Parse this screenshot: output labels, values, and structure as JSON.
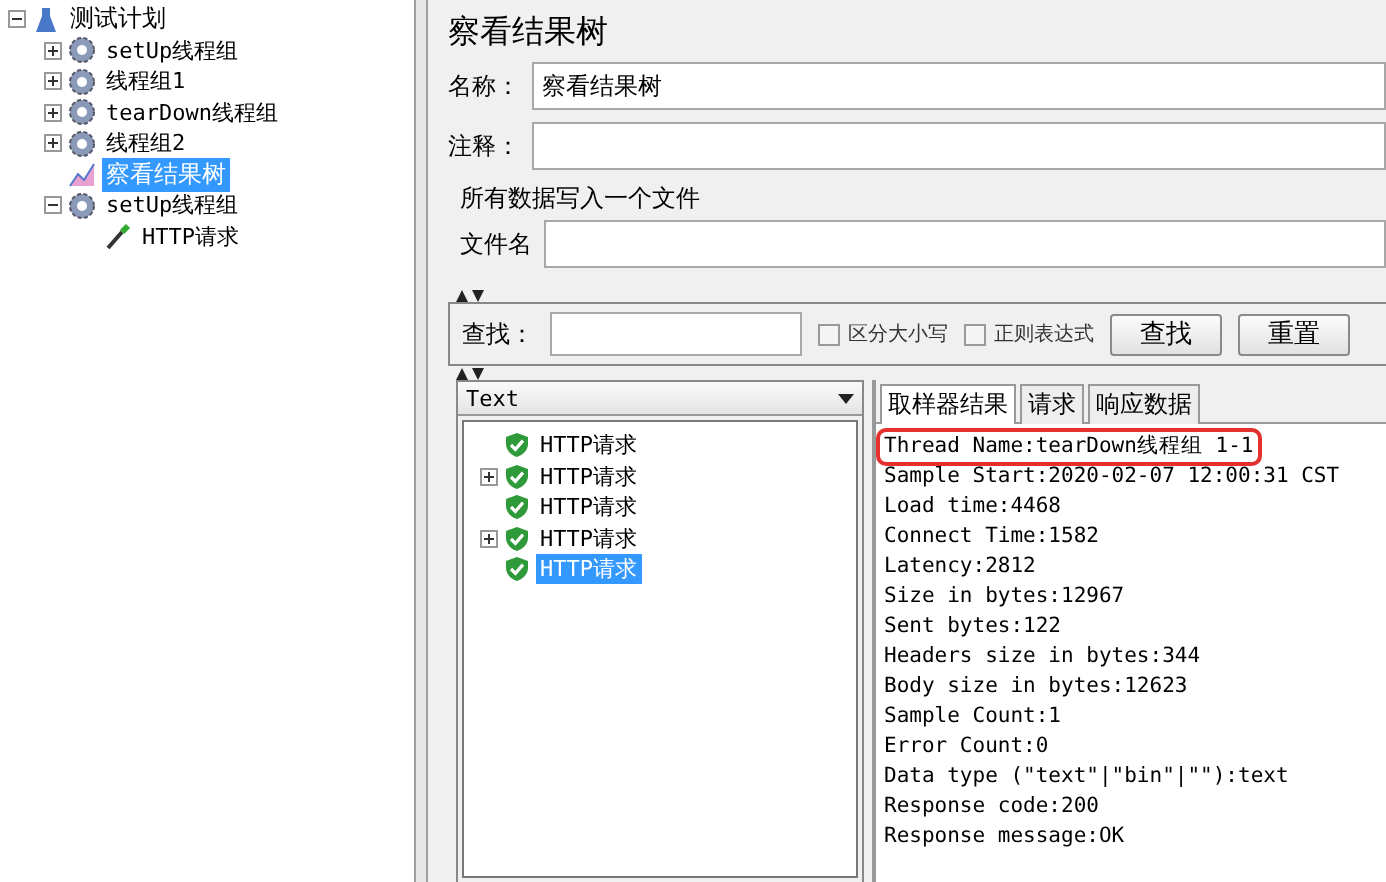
{
  "test_plan": {
    "label": "测试计划",
    "expanded": true,
    "children": [
      {
        "label": "setUp线程组",
        "kind": "thread_group",
        "expanded": false,
        "selected": false
      },
      {
        "label": "线程组1",
        "kind": "thread_group",
        "expanded": false,
        "selected": false
      },
      {
        "label": "tearDown线程组",
        "kind": "thread_group",
        "expanded": false,
        "selected": false
      },
      {
        "label": "线程组2",
        "kind": "thread_group",
        "expanded": false,
        "selected": false
      },
      {
        "label": "察看结果树",
        "kind": "listener",
        "selected": true
      },
      {
        "label": "setUp线程组",
        "kind": "thread_group",
        "expanded": true,
        "selected": false,
        "children": [
          {
            "label": "HTTP请求",
            "kind": "sampler",
            "selected": false
          }
        ]
      }
    ]
  },
  "panel": {
    "title": "察看结果树",
    "name_label": "名称：",
    "name_value": "察看结果树",
    "comment_label": "注释：",
    "file_group": "所有数据写入一个文件",
    "file_label": "文件名"
  },
  "search": {
    "label": "查找：",
    "case_sensitive": {
      "label": "区分大小写",
      "checked": false
    },
    "regex": {
      "label": "正则表达式",
      "checked": false
    },
    "buttons": [
      "查找",
      "重置"
    ]
  },
  "renderer": "Text",
  "results": [
    {
      "label": "HTTP请求",
      "expandable": false,
      "selected": false
    },
    {
      "label": "HTTP请求",
      "expandable": true,
      "selected": false
    },
    {
      "label": "HTTP请求",
      "expandable": false,
      "selected": false
    },
    {
      "label": "HTTP请求",
      "expandable": true,
      "selected": false
    },
    {
      "label": "HTTP请求",
      "expandable": false,
      "selected": true
    }
  ],
  "tabs": [
    {
      "label": "取样器结果",
      "selected": true
    },
    {
      "label": "请求",
      "selected": false
    },
    {
      "label": "响应数据",
      "selected": false
    }
  ],
  "sample_result": [
    {
      "text": "Thread Name:tearDown线程组 1-1",
      "highlighted": true
    },
    {
      "text": "Sample Start:2020-02-07 12:00:31 CST",
      "highlighted": false
    },
    {
      "text": "Load time:4468",
      "highlighted": false
    },
    {
      "text": "Connect Time:1582",
      "highlighted": false
    },
    {
      "text": "Latency:2812",
      "highlighted": false
    },
    {
      "text": "Size in bytes:12967",
      "highlighted": false
    },
    {
      "text": "Sent bytes:122",
      "highlighted": false
    },
    {
      "text": "Headers size in bytes:344",
      "highlighted": false
    },
    {
      "text": "Body size in bytes:12623",
      "highlighted": false
    },
    {
      "text": "Sample Count:1",
      "highlighted": false
    },
    {
      "text": "Error Count:0",
      "highlighted": false
    },
    {
      "text": "Data type (\"text\"|\"bin\"|\"\"):text",
      "highlighted": false
    },
    {
      "text": "Response code:200",
      "highlighted": false
    },
    {
      "text": "Response message:OK",
      "highlighted": false
    }
  ]
}
